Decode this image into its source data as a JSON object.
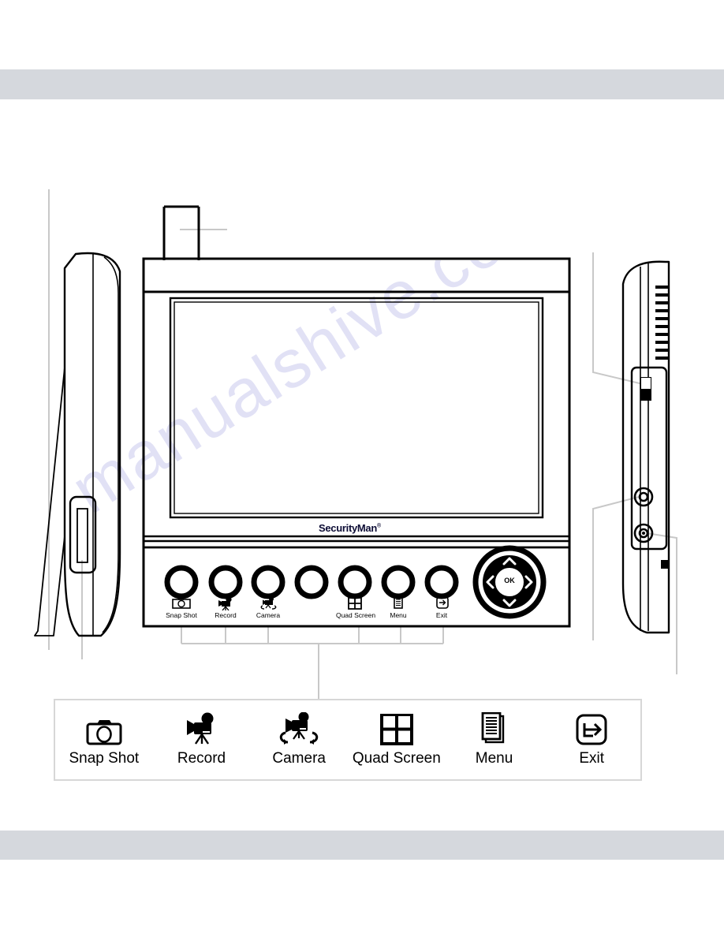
{
  "page": {
    "brand": "SecurityMan",
    "brand_mark": "®",
    "watermark": "manualshive.com"
  },
  "device": {
    "front_panel": {
      "buttons": [
        {
          "label": "Snap Shot",
          "icon": "snapshot-icon",
          "has_label": true
        },
        {
          "label": "Record",
          "icon": "record-icon",
          "has_label": true
        },
        {
          "label": "Camera",
          "icon": "camera-icon",
          "has_label": true
        },
        {
          "label": "",
          "icon": "",
          "has_label": false
        },
        {
          "label": "Quad Screen",
          "icon": "quad-screen-icon",
          "has_label": true
        },
        {
          "label": "Menu",
          "icon": "menu-icon",
          "has_label": true
        },
        {
          "label": "Exit",
          "icon": "exit-icon",
          "has_label": true
        }
      ],
      "navpad": {
        "ok_label": "OK",
        "up": "up-arrow-icon",
        "down": "down-arrow-icon",
        "left": "left-arrow-icon",
        "right": "right-arrow-icon"
      }
    },
    "left_side_view": {
      "name": "left-side-view",
      "features": [
        "kickstand",
        "sd-card-slot"
      ]
    },
    "right_side_view": {
      "name": "right-side-view",
      "features": [
        "speaker-vents",
        "power-switch",
        "av-jack",
        "dc-jack",
        "reset-button"
      ]
    },
    "antenna": "antenna"
  },
  "legend": {
    "items": [
      {
        "label": "Snap Shot",
        "icon": "snapshot-icon"
      },
      {
        "label": "Record",
        "icon": "record-icon"
      },
      {
        "label": "Camera",
        "icon": "camera-icon"
      },
      {
        "label": "Quad Screen",
        "icon": "quad-screen-icon"
      },
      {
        "label": "Menu",
        "icon": "menu-icon"
      },
      {
        "label": "Exit",
        "icon": "exit-icon"
      }
    ]
  },
  "colors": {
    "band": "#d5d8dd",
    "line": "#000000",
    "leader": "#c8c8c8",
    "watermark": "#c9c9ee",
    "brand": "#0d0d35"
  }
}
